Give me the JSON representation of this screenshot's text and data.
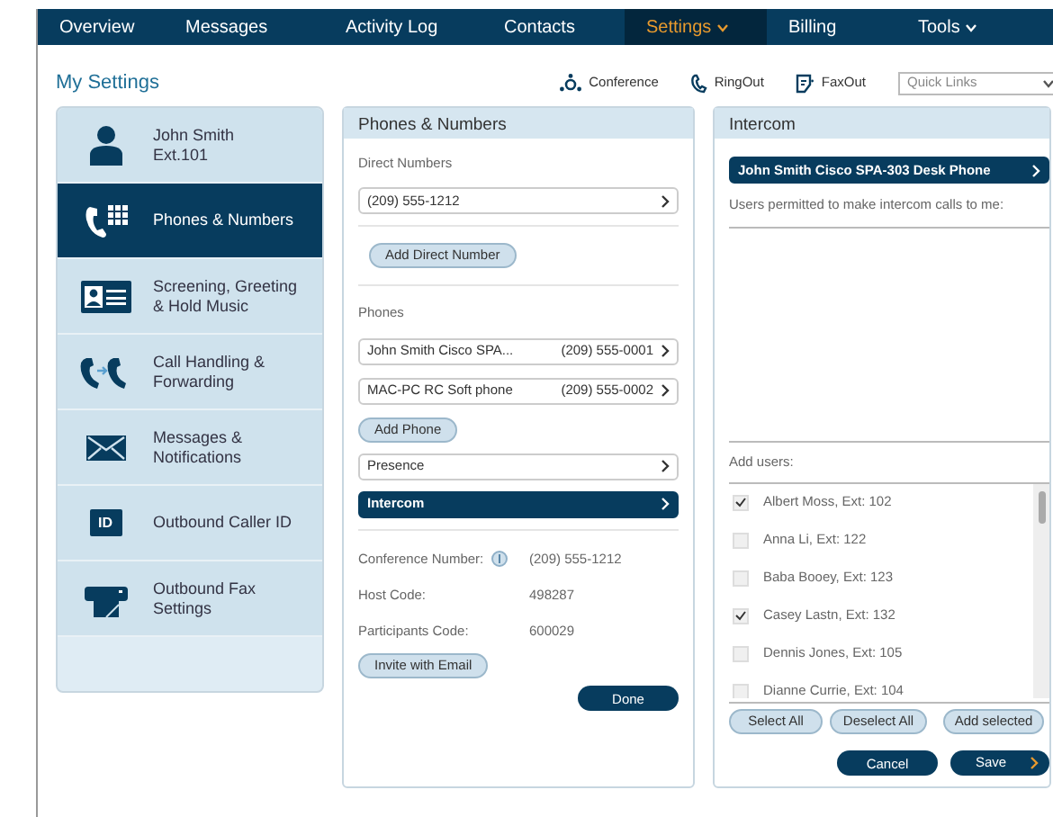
{
  "nav": [
    {
      "label": "Overview",
      "selected": false,
      "dropdown": false
    },
    {
      "label": "Messages",
      "selected": false,
      "dropdown": false
    },
    {
      "label": "Activity Log",
      "selected": false,
      "dropdown": false
    },
    {
      "label": "Contacts",
      "selected": false,
      "dropdown": false
    },
    {
      "label": "Settings",
      "selected": true,
      "dropdown": true
    },
    {
      "label": "Billing",
      "selected": false,
      "dropdown": false
    },
    {
      "label": "Tools",
      "selected": false,
      "dropdown": true
    }
  ],
  "header": {
    "title": "My Settings",
    "actions": [
      {
        "label": "Conference",
        "kind": "conference"
      },
      {
        "label": "RingOut",
        "kind": "phone"
      },
      {
        "label": "FaxOut",
        "kind": "fax"
      }
    ],
    "quick_links": {
      "placeholder": "Quick Links"
    }
  },
  "sidebar": {
    "items": [
      {
        "lines": [
          "John Smith",
          "Ext.101"
        ],
        "kind": "person",
        "selected": false
      },
      {
        "lines": [
          "Phones & Numbers"
        ],
        "kind": "phone-grid",
        "selected": true
      },
      {
        "lines": [
          "Screening, Greeting",
          "& Hold Music"
        ],
        "kind": "id-card",
        "selected": false
      },
      {
        "lines": [
          "Call Handling &",
          "Forwarding"
        ],
        "kind": "forward",
        "selected": false
      },
      {
        "lines": [
          "Messages &",
          "Notifications"
        ],
        "kind": "envelope",
        "selected": false
      },
      {
        "lines": [
          "Outbound Caller ID"
        ],
        "kind": "id",
        "selected": false,
        "icon_text": "ID"
      },
      {
        "lines": [
          "Outbound Fax",
          "Settings"
        ],
        "kind": "fax",
        "selected": false
      }
    ]
  },
  "phones_panel": {
    "title": "Phones & Numbers",
    "direct_label": "Direct Numbers",
    "direct_numbers": [
      {
        "label": "(209) 555-1212"
      }
    ],
    "add_direct": "Add Direct Number",
    "phones_label": "Phones",
    "phones": [
      {
        "label": "John Smith Cisco SPA...",
        "number": "(209) 555-0001"
      },
      {
        "label": "MAC-PC RC Soft phone",
        "number": "(209) 555-0002"
      }
    ],
    "add_phone": "Add Phone",
    "links": [
      {
        "label": "Presence",
        "selected": false
      },
      {
        "label": "Intercom",
        "selected": true
      }
    ],
    "conference": [
      {
        "label": "Conference Number:",
        "value": "(209) 555-1212",
        "info": true
      },
      {
        "label": "Host Code:",
        "value": "498287",
        "info": false
      },
      {
        "label": "Participants Code:",
        "value": "600029",
        "info": false
      }
    ],
    "invite": "Invite with Email",
    "done": "Done"
  },
  "intercom_panel": {
    "title": "Intercom",
    "device": "John Smith Cisco SPA-303 Desk Phone",
    "permitted_label": "Users permitted to make intercom calls to me:",
    "add_label": "Add users:",
    "users": [
      {
        "label": "Albert Moss, Ext: 102",
        "checked": true
      },
      {
        "label": "Anna Li, Ext: 122",
        "checked": false
      },
      {
        "label": "Baba Booey, Ext: 123",
        "checked": false
      },
      {
        "label": "Casey Lastn, Ext: 132",
        "checked": true
      },
      {
        "label": "Dennis Jones, Ext: 105",
        "checked": false
      },
      {
        "label": "Dianne Currie, Ext: 104",
        "checked": false
      }
    ],
    "list_buttons": [
      "Select All",
      "Deselect All",
      "Add selected"
    ],
    "cancel": "Cancel",
    "save": "Save"
  }
}
